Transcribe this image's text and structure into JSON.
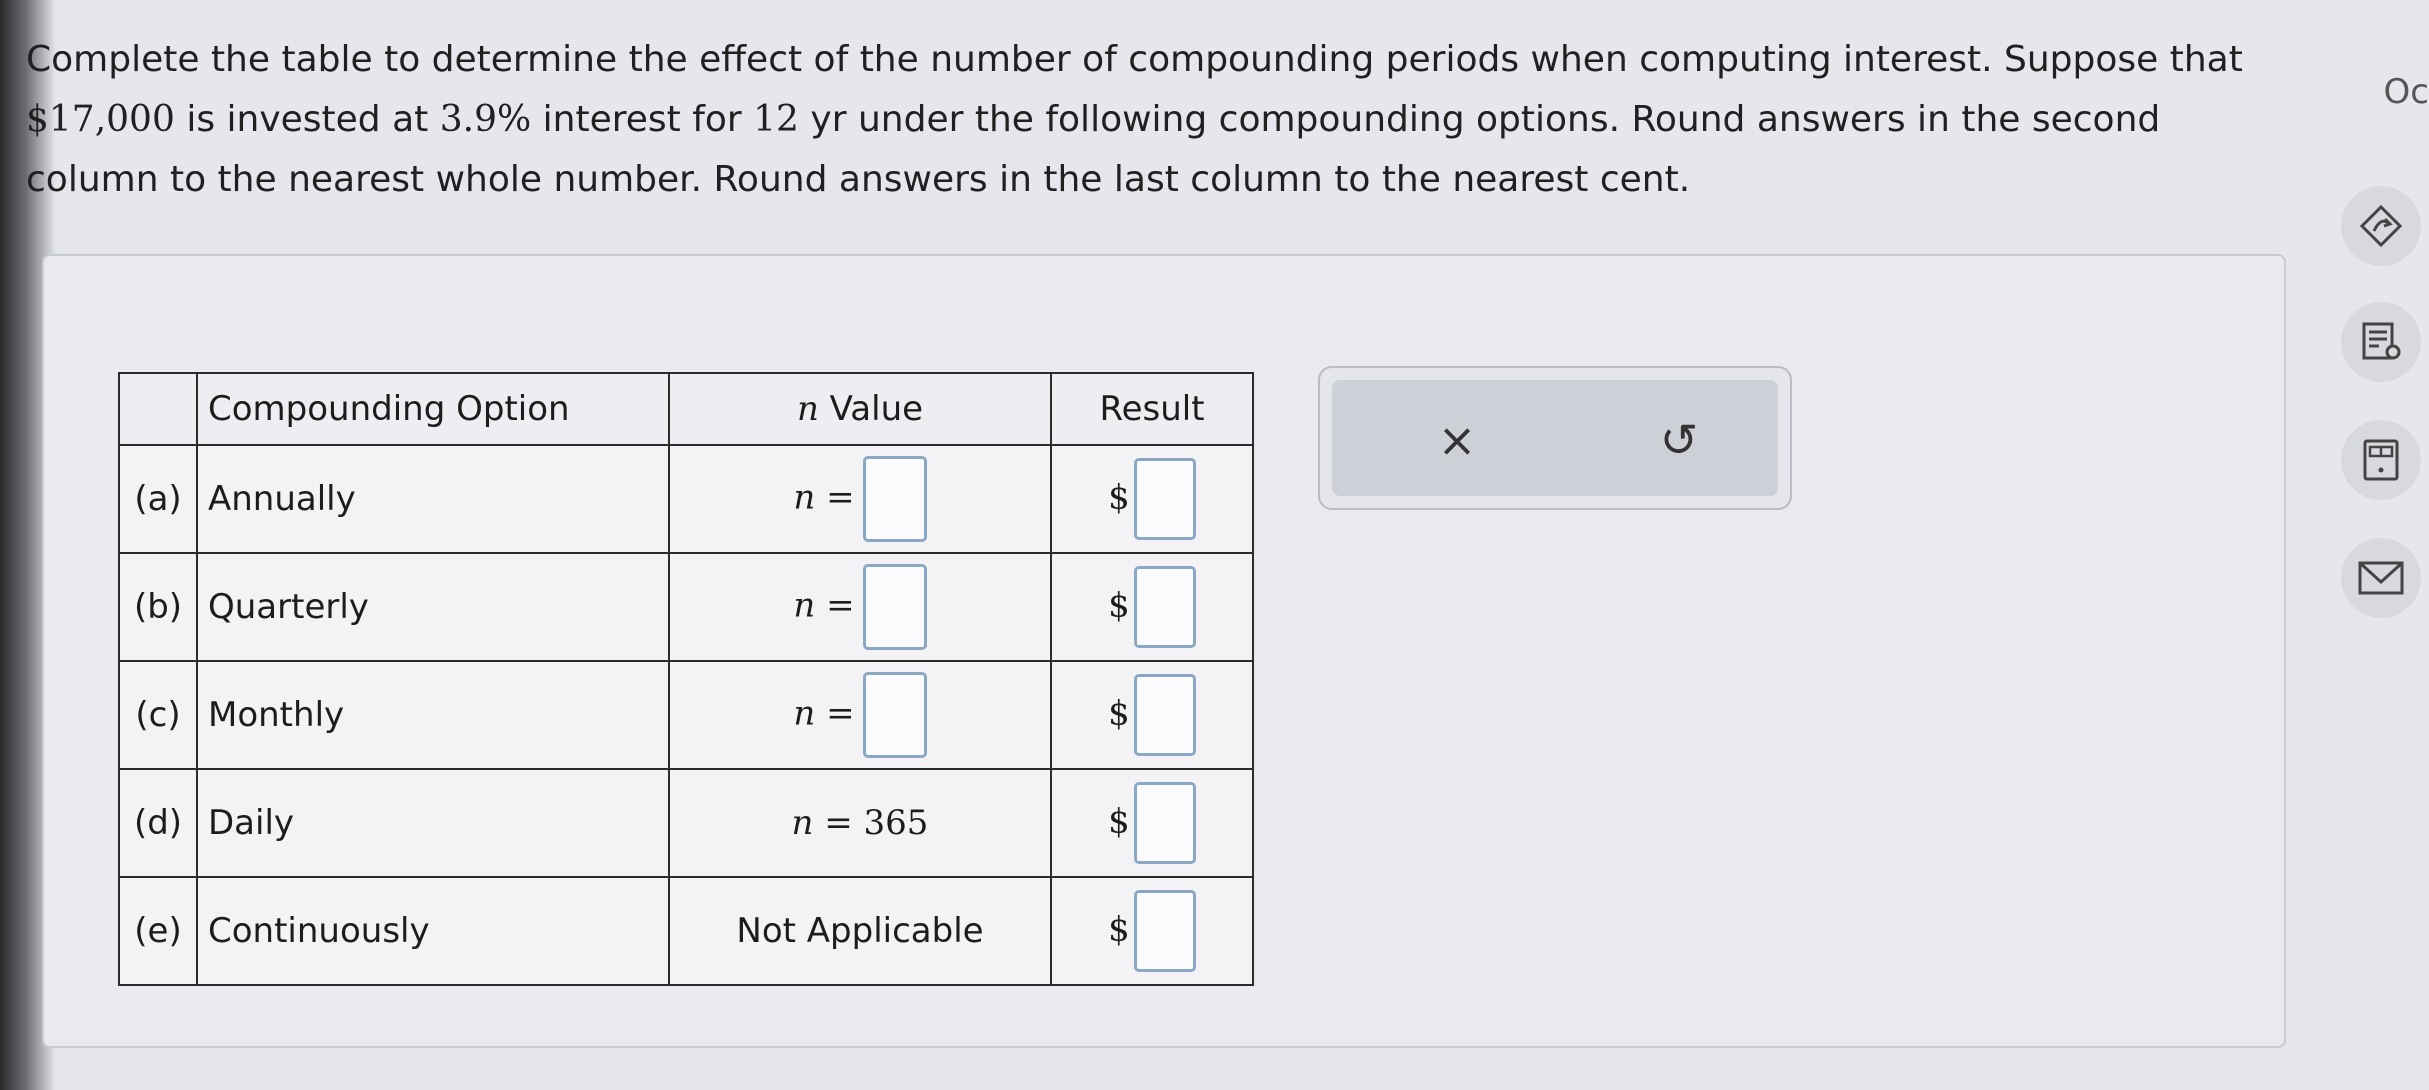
{
  "question": {
    "line1": "Complete the table to determine the effect of the number of compounding periods when computing interest. Suppose that",
    "amount": "$17,000",
    "mid1": " is invested at ",
    "rate": "3.9%",
    "mid2": " interest for ",
    "years": "12",
    "mid3": " yr under the following compounding options. Round answers in the second",
    "line3": "column to the nearest whole number. Round answers in the last column to the nearest cent."
  },
  "table": {
    "headers": [
      "",
      "Compounding Option",
      "Value",
      "Result"
    ],
    "header_n_symbol": "n",
    "rows": [
      {
        "label": "(a)",
        "option": "Annually",
        "n_prefix": "n =",
        "n_value": "",
        "currency": "$"
      },
      {
        "label": "(b)",
        "option": "Quarterly",
        "n_prefix": "n =",
        "n_value": "",
        "currency": "$"
      },
      {
        "label": "(c)",
        "option": "Monthly",
        "n_prefix": "n =",
        "n_value": "",
        "currency": "$"
      },
      {
        "label": "(d)",
        "option": "Daily",
        "n_prefix": "n =",
        "n_value": "365",
        "currency": "$"
      },
      {
        "label": "(e)",
        "option": "Continuously",
        "n_text": "Not Applicable",
        "currency": "$"
      }
    ]
  },
  "actions": {
    "clear_symbol": "×",
    "undo_symbol": "↺"
  },
  "corner_text": "Oc",
  "icons": [
    "clear-icon",
    "undo-icon",
    "question-help-icon",
    "textbook-icon",
    "calculator-icon",
    "mail-icon"
  ]
}
